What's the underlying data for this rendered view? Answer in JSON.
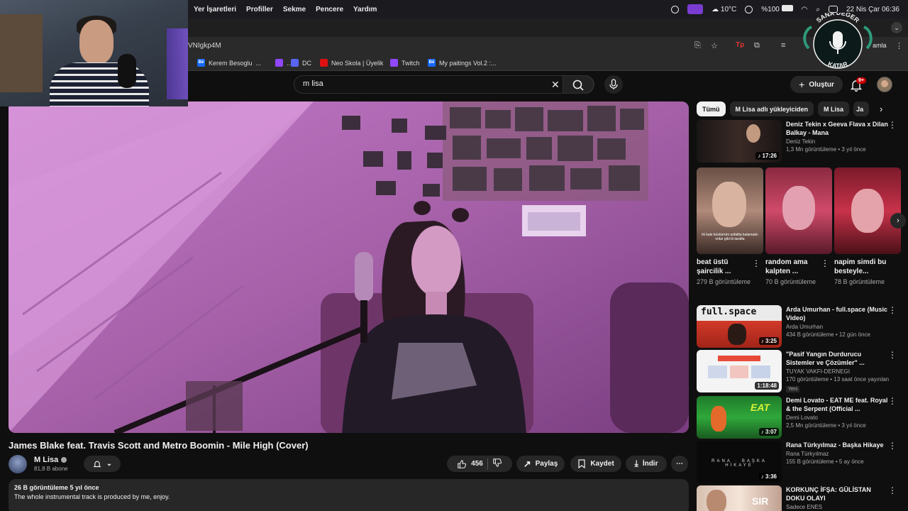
{
  "menubar": {
    "menus": [
      "Yer İşaretleri",
      "Profiller",
      "Sekme",
      "Pencere",
      "Yardım"
    ],
    "weather": "10°C",
    "battery": "%100",
    "datetime": "22 Nis Çar  06:36"
  },
  "browser": {
    "url": "VNIgkp4M",
    "profile_button": "amla",
    "bookmarks": [
      {
        "label": "Kerem Besoglu",
        "suffix": "...",
        "icon": "behance-icon",
        "color": "#1769ff"
      },
      {
        "label": "...",
        "icon": "twitch-icon",
        "color": "#9146ff"
      },
      {
        "label": "DC",
        "icon": "discord-icon",
        "color": "#5865f2"
      },
      {
        "label": "Neo Skola | Üyelik",
        "icon": "neo-skola-icon",
        "color": "#d11"
      },
      {
        "label": "Twitch",
        "icon": "twitch-icon",
        "color": "#9146ff"
      },
      {
        "label": "My paitings Vol.2 :...",
        "icon": "behance-icon",
        "color": "#1769ff"
      }
    ]
  },
  "logo": {
    "top_text": "SANA DEĞER",
    "bottom_text": "KATAR"
  },
  "youtube": {
    "search_value": "m lisa",
    "create_label": "Oluştur",
    "notif_badge": "9+"
  },
  "video": {
    "title": "James Blake feat. Travis Scott and Metro Boomin - Mile High (Cover)",
    "channel": "M Lisa",
    "subscribers": "81,8 B abone",
    "likes": "456",
    "share_label": "Paylaş",
    "save_label": "Kaydet",
    "download_label": "İndir",
    "views_and_date": "26 B görüntüleme  5 yıl önce",
    "description": "The whole instrumental track is produced by me, enjoy."
  },
  "sidebar": {
    "chips": [
      "Tümü",
      "M Lisa adlı yükleyiciden",
      "M Lisa",
      "Ja"
    ],
    "recommendations": [
      {
        "title": "Deniz Tekin x Geeva Flava x Dilan Balkay - Mana",
        "channel": "Deniz Tekin",
        "meta": "1,3 Mn görüntüleme • 3 yıl önce",
        "duration": "17:26",
        "new": ""
      },
      {
        "title": "Arda Umurhan - full.space (Music Video)",
        "channel": "Arda Umurhan",
        "meta": "434 B görüntüleme • 12 gün önce",
        "duration": "3:25",
        "new": ""
      },
      {
        "title": "\"Pasif Yangın Durdurucu Sistemler ve Çözümler\" ...",
        "channel": "TUYAK VAKFI-DERNEGI",
        "meta": "170 görüntüleme • 13 saat önce yayınlan",
        "duration": "1:18:48",
        "new": "Yeni"
      },
      {
        "title": "Demi Lovato - EAT ME feat. Royal & the Serpent (Official ...",
        "channel": "Demi Lovato",
        "meta": "2,5 Mn görüntüleme • 3 yıl önce",
        "duration": "3:07",
        "new": ""
      },
      {
        "title": "Rana Türkyılmaz - Başka Hikaye",
        "channel": "Rana Türkyılmaz",
        "meta": "155 B görüntüleme • 5 ay önce",
        "duration": "3:36",
        "new": ""
      },
      {
        "title": "KORKUNÇ İFŞA: GÜLİSTAN DOKU OLAYI",
        "channel": "Sadece ENES",
        "meta": "",
        "duration": "",
        "new": ""
      }
    ],
    "shorts": [
      {
        "title": "beat üstü şaircilik ...",
        "views": "279 B görüntüleme",
        "caption": "iki kale küstürrüm asfaltta kalamadıı onlar gibi bi tarafta"
      },
      {
        "title": "random ama kalpten ...",
        "views": "70 B görüntüleme",
        "caption": ""
      },
      {
        "title": "napim simdi bu besteyle...",
        "views": "78 B görüntüleme",
        "caption": ""
      }
    ]
  }
}
